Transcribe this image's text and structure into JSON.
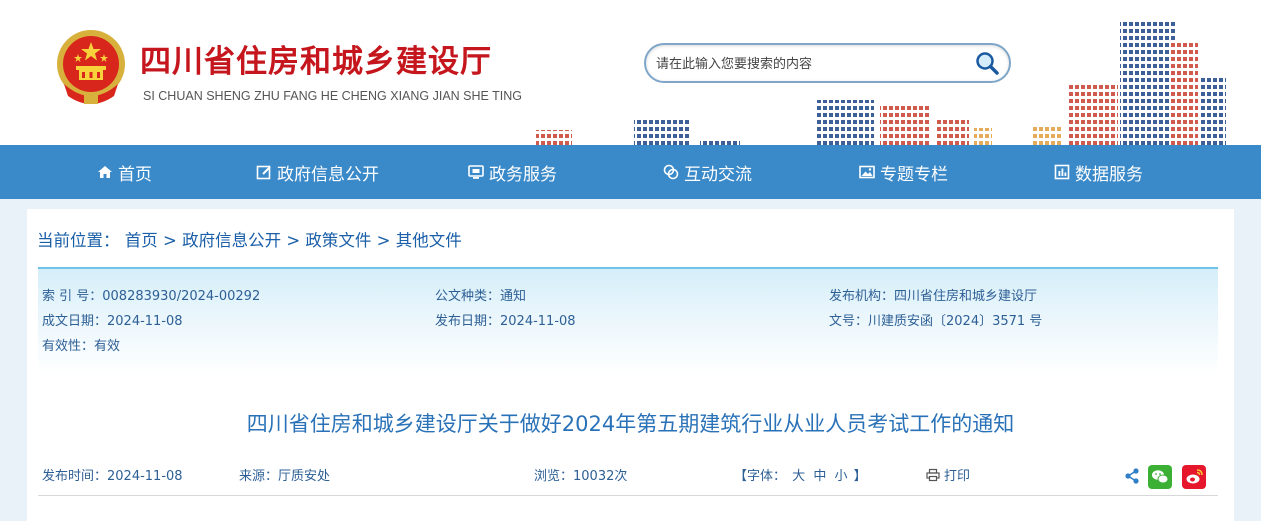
{
  "header": {
    "title": "四川省住房和城乡建设厅",
    "subtitle": "SI CHUAN SHENG ZHU FANG HE CHENG XIANG JIAN SHE TING",
    "search_placeholder": "请在此输入您要搜索的内容"
  },
  "nav": {
    "items": [
      {
        "label": "首页",
        "icon": "home-icon"
      },
      {
        "label": "政府信息公开",
        "icon": "edit-icon"
      },
      {
        "label": "政务服务",
        "icon": "monitor-icon"
      },
      {
        "label": "互动交流",
        "icon": "chat-icon"
      },
      {
        "label": "专题专栏",
        "icon": "image-icon"
      },
      {
        "label": "数据服务",
        "icon": "chart-icon"
      }
    ]
  },
  "breadcrumb": {
    "prefix": "当前位置：",
    "items": [
      "首页",
      "政府信息公开",
      "政策文件",
      "其他文件"
    ],
    "separator": ">"
  },
  "meta": {
    "index_no": "索 引 号：008283930/2024-00292",
    "doc_type": "公文种类：通知",
    "publisher": "发布机构：四川省住房和城乡建设厅",
    "created_date": "成文日期：2024-11-08",
    "publish_date": "发布日期：2024-11-08",
    "doc_no": "文号：川建质安函〔2024〕3571 号",
    "validity": "有效性：有效"
  },
  "article": {
    "title": "四川省住房和城乡建设厅关于做好2024年第五期建筑行业从业人员考试工作的通知",
    "publish_time": "发布时间：2024-11-08",
    "source": "来源：厅质安处",
    "views": "浏览：10032次",
    "font_label_open": "【字体：",
    "font_large": "大",
    "font_medium": "中",
    "font_small": "小",
    "font_label_close": "】",
    "print": "打印"
  },
  "colors": {
    "brand_red": "#c4161c",
    "nav_blue": "#3a89c9",
    "link_blue": "#1a5fa8",
    "title_blue": "#2a72b8",
    "wechat_green": "#3cb034",
    "weibo_red": "#e6162d"
  }
}
